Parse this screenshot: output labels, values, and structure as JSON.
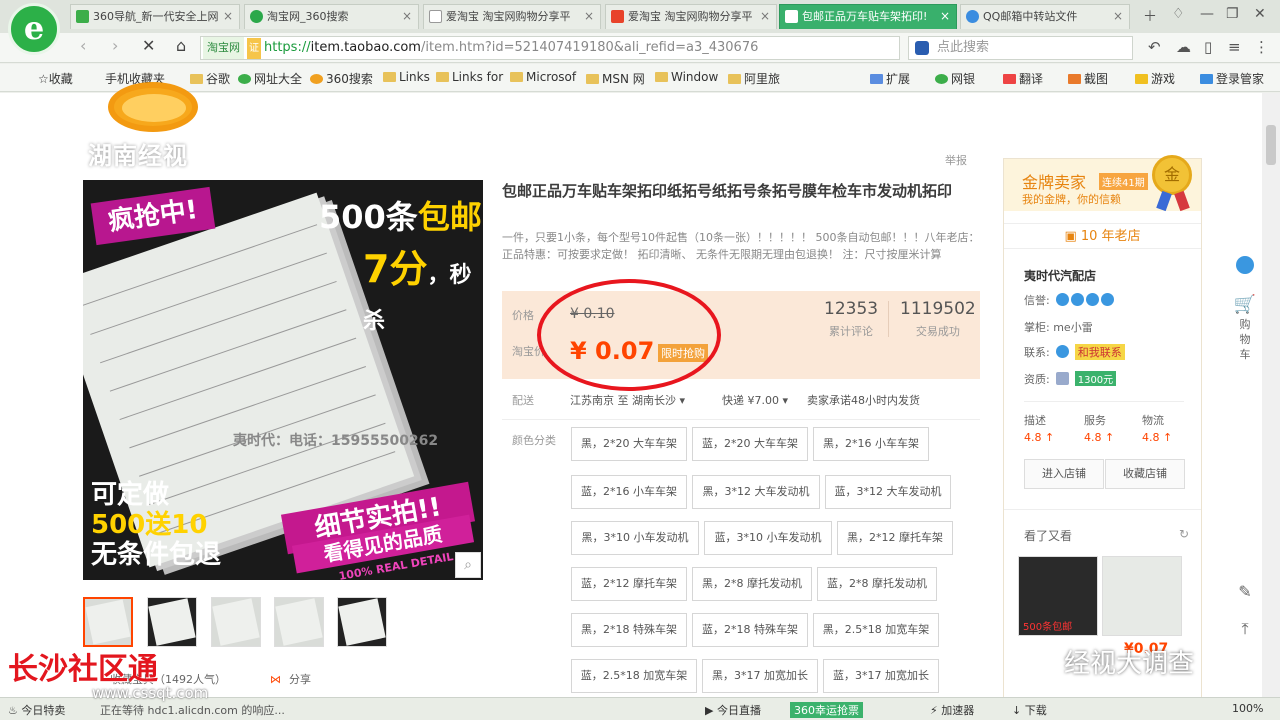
{
  "browser": {
    "logo_glyph": "e",
    "tabs": [
      {
        "label": "360导航_新一代安全上网",
        "icon_color": "#3cae4a"
      },
      {
        "label": "淘宝网_360搜索",
        "icon_color": "#2ba84a"
      },
      {
        "label": "爱淘宝 淘宝网购物分享平",
        "icon_color": "#999999"
      },
      {
        "label": "爱淘宝 淘宝网购物分享平",
        "icon_color": "#e8432a"
      },
      {
        "label": "包邮正品万车贴车架拓印!",
        "icon_color": "#ffffff"
      },
      {
        "label": "QQ邮箱中转站文件",
        "icon_color": "#3b8de0"
      }
    ],
    "url_site_tag": "淘宝网",
    "url_verify": "证",
    "url_https": "https://",
    "url_domain": "item.taobao.com",
    "url_rest": "/item.htm?id=521407419180&ali_refid=a3_430676",
    "search_placeholder": "点此搜索",
    "bookmarks": [
      "收藏",
      "手机收藏夹",
      "谷歌",
      "网址大全",
      "360搜索",
      "Links",
      "Links for",
      "Microsof",
      "MSN 网",
      "Window",
      "阿里旅"
    ],
    "bookmarks_right": [
      "扩展",
      "网银",
      "翻译",
      "截图",
      "游戏",
      "登录管家"
    ]
  },
  "overlay": {
    "tv_logo": "湖南经视",
    "watermark_left": "长沙社区通",
    "watermark_url": "www.cssqt.com",
    "watermark_right": "经视大调查"
  },
  "product": {
    "report": "举报",
    "title": "包邮正品万车贴车架拓印纸拓号纸拓号条拓号膜年检车市发动机拓印",
    "desc": "一件，只要1小条，每个型号10件起售（10条一张）！！！！！ 500条自动包邮！！！八年老店：正品特惠：可按要求定做！ 拓印清晰、 无条件无限期无理由包退换！ 注：尺寸按厘米计算",
    "image": {
      "badge": "疯抢中!",
      "headline": "500条",
      "headline_y": "包邮",
      "price_line": "7分",
      "price_suffix": "，秒杀",
      "phone": "夷时代：电话：15955500262",
      "custom_1": "可定做",
      "custom_2": "500送10",
      "custom_3": "无条件包退",
      "detail": "细节实拍!!",
      "quality": "看得见的品质",
      "real": "100% REAL DETAIL"
    },
    "price_label": "价格",
    "price_original": "¥ 0.10",
    "taobao_label": "淘宝价",
    "price_sale": "¥ 0.07",
    "flash_tag": "限时抢购",
    "stats": [
      {
        "num": "12353",
        "label": "累计评论"
      },
      {
        "num": "1119502",
        "label": "交易成功"
      }
    ],
    "ship_label": "配送",
    "ship_from": "江苏南京 至 湖南长沙",
    "ship_fee": "快递 ¥7.00",
    "ship_promise": "卖家承诺48小时内发货",
    "color_label": "颜色分类",
    "options": [
      "黑，2*20 大车车架",
      "蓝，2*20 大车车架",
      "黑，2*16 小车车架",
      "蓝，2*16 小车车架",
      "黑，3*12 大车发动机",
      "蓝，3*12 大车发动机",
      "黑，3*10 小车发动机",
      "蓝，3*10 小车发动机",
      "黑，2*12 摩托车架",
      "蓝，2*12 摩托车架",
      "黑，2*8 摩托发动机",
      "蓝，2*8 摩托发动机",
      "黑，2*18 特殊车架",
      "蓝，2*18 特殊车架",
      "黑，2.5*18 加宽车架",
      "蓝，2.5*18 加宽车架",
      "黑，3*17 加宽加长",
      "蓝，3*17 加宽加长"
    ],
    "share": "分享",
    "favorite": "收藏宝贝（1492人气）"
  },
  "seller": {
    "gold_title": "金牌卖家",
    "gold_period": "连续41期",
    "gold_sub": "我的金牌，你的信赖",
    "medal": "金",
    "years": "10 年老店",
    "shop_name": "夷时代汽配店",
    "credit_label": "信誉:",
    "keeper_label": "掌柜:",
    "keeper": "me小雷",
    "contact_label": "联系:",
    "contact_btn": "和我联系",
    "deposit_label": "资质:",
    "deposit": "1300元",
    "scores": [
      {
        "name": "描述",
        "value": "4.8 ↑"
      },
      {
        "name": "服务",
        "value": "4.8 ↑"
      },
      {
        "name": "物流",
        "value": "4.8 ↑"
      }
    ],
    "enter_shop": "进入店铺",
    "fav_shop": "收藏店铺",
    "see_also": "看了又看",
    "rec_price": "¥0.07",
    "rec_caption": "500条包邮"
  },
  "rightpanel": {
    "cart": "购物车"
  },
  "status": {
    "left": "今日特卖",
    "loading": "正在等待 hdc1.alicdn.com 的响应...",
    "live": "今日直播",
    "express": "360幸运抢票",
    "accel": "加速器",
    "download": "下载",
    "zoom": "100%"
  }
}
